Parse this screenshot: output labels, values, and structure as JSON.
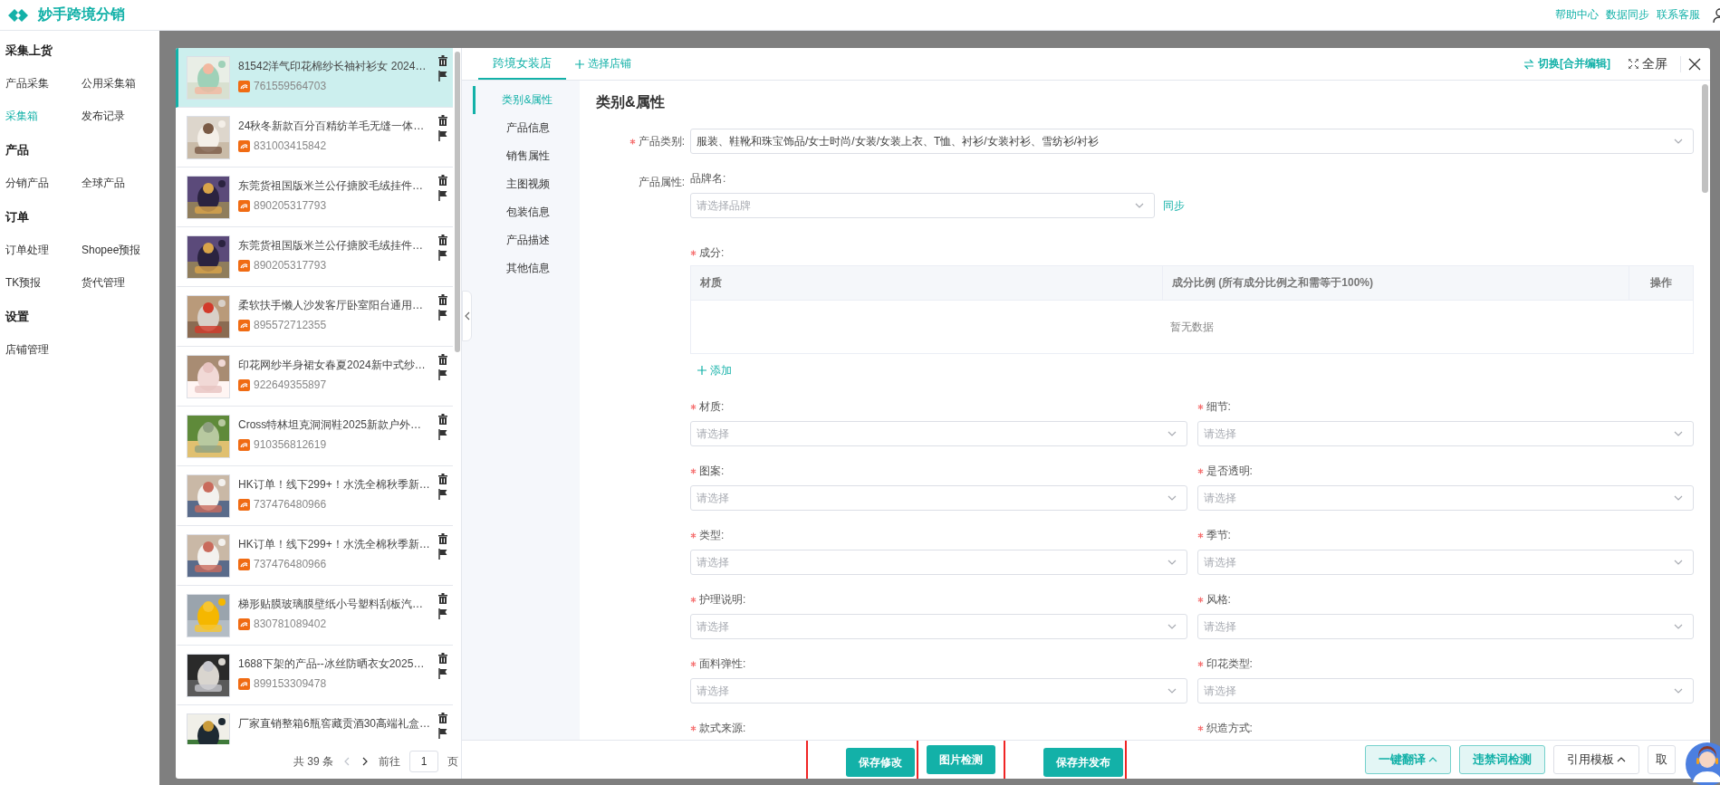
{
  "app": {
    "title": "妙手跨境分销"
  },
  "header_links": [
    "帮助中心",
    "数据同步",
    "联系客服"
  ],
  "sidebar": {
    "sections": [
      {
        "title": "采集上货",
        "items": [
          {
            "label": "产品采集",
            "selected": false
          },
          {
            "label": "公用采集箱",
            "selected": false
          },
          {
            "label": "采集箱",
            "selected": true
          },
          {
            "label": "发布记录",
            "selected": false
          }
        ]
      },
      {
        "title": "产品",
        "items": [
          {
            "label": "分销产品",
            "selected": false
          },
          {
            "label": "全球产品",
            "selected": false
          }
        ]
      },
      {
        "title": "订单",
        "items": [
          {
            "label": "订单处理",
            "selected": false
          },
          {
            "label": "Shopee预报",
            "selected": false
          },
          {
            "label": "TK预报",
            "selected": false
          },
          {
            "label": "货代管理",
            "selected": false
          }
        ]
      },
      {
        "title": "设置",
        "items": [
          {
            "label": "店铺管理",
            "selected": false
          }
        ]
      }
    ]
  },
  "product_list": {
    "items": [
      {
        "title": "81542洋气印花棉纱长袖衬衫女 2024…",
        "id": "761559564703",
        "selected": true,
        "kind": "picture"
      },
      {
        "title": "24秋冬新款百分百精纺羊毛无缝一体…",
        "id": "831003415842",
        "selected": false,
        "kind": "picture"
      },
      {
        "title": "东莞货祖国版米兰公仔搪胶毛绒挂件…",
        "id": "890205317793",
        "selected": false,
        "kind": "picture"
      },
      {
        "title": "东莞货祖国版米兰公仔搪胶毛绒挂件…",
        "id": "890205317793",
        "selected": false,
        "kind": "picture"
      },
      {
        "title": "柔软扶手懒人沙发客厅卧室阳台通用…",
        "id": "895572712355",
        "selected": false,
        "kind": "picture"
      },
      {
        "title": "印花网纱半身裙女春夏2024新中式纱…",
        "id": "922649355897",
        "selected": false,
        "kind": "picture"
      },
      {
        "title": "Cross特林坦克洞洞鞋2025新款户外…",
        "id": "910356812619",
        "selected": false,
        "kind": "picture"
      },
      {
        "title": "HK订单！线下299+！水洗全棉秋季新…",
        "id": "737476480966",
        "selected": false,
        "kind": "picture"
      },
      {
        "title": "HK订单！线下299+！水洗全棉秋季新…",
        "id": "737476480966",
        "selected": false,
        "kind": "picture"
      },
      {
        "title": "梯形贴膜玻璃膜壁纸小号塑料刮板汽…",
        "id": "830781089402",
        "selected": false,
        "kind": "picture"
      },
      {
        "title": "1688下架的产品--冰丝防晒衣女2025…",
        "id": "899153309478",
        "selected": false,
        "kind": "picture"
      },
      {
        "title": "厂家直销整箱6瓶窖藏贡酒30高端礼盒…",
        "selected": false,
        "kind": "picture"
      }
    ],
    "pagination": {
      "total": "共 39 条",
      "goto": "前往",
      "page": "1",
      "unit": "页"
    }
  },
  "editor": {
    "tabs": [
      {
        "label": "跨境女装店",
        "selected": true
      }
    ],
    "add_shop": "选择店铺",
    "switch_mode": "切换[合并编辑]",
    "fullscreen": "全屏",
    "nav": [
      {
        "label": "类别&属性",
        "selected": true
      },
      {
        "label": "产品信息",
        "selected": false
      },
      {
        "label": "销售属性",
        "selected": false
      },
      {
        "label": "主图视频",
        "selected": false
      },
      {
        "label": "包装信息",
        "selected": false
      },
      {
        "label": "产品描述",
        "selected": false
      },
      {
        "label": "其他信息",
        "selected": false
      }
    ],
    "section_title": "类别&属性",
    "category": {
      "label": "产品类别:",
      "required": true,
      "value": "服装、鞋靴和珠宝饰品/女士时尚/女装/女装上衣、T恤、衬衫/女装衬衫、雪纺衫/衬衫"
    },
    "attributes_label": "产品属性:",
    "brand": {
      "label": "品牌名:",
      "required": false,
      "placeholder": "请选择品牌",
      "sync": "同步"
    },
    "composition": {
      "label": "成分:",
      "required": true,
      "columns": [
        "材质",
        "成分比例 (所有成分比例之和需等于100%)",
        "操作"
      ],
      "empty": "暂无数据",
      "add": "添加"
    },
    "fields": [
      {
        "label": "材质:",
        "required": true,
        "placeholder": "请选择"
      },
      {
        "label": "细节:",
        "required": true,
        "placeholder": "请选择"
      },
      {
        "label": "图案:",
        "required": true,
        "placeholder": "请选择"
      },
      {
        "label": "是否透明:",
        "required": true,
        "placeholder": "请选择"
      },
      {
        "label": "类型:",
        "required": true,
        "placeholder": "请选择"
      },
      {
        "label": "季节:",
        "required": true,
        "placeholder": "请选择"
      },
      {
        "label": "护理说明:",
        "required": true,
        "placeholder": "请选择"
      },
      {
        "label": "风格:",
        "required": true,
        "placeholder": "请选择"
      },
      {
        "label": "面料弹性:",
        "required": true,
        "placeholder": "请选择"
      },
      {
        "label": "印花类型:",
        "required": true,
        "placeholder": "请选择"
      },
      {
        "label": "款式来源:",
        "required": true
      },
      {
        "label": "织造方式:",
        "required": true
      }
    ],
    "footer": {
      "center_buttons": [
        {
          "label": "保存修改",
          "highlighted": true
        },
        {
          "label": "图片检测",
          "highlighted": false
        },
        {
          "label": "保存并发布",
          "highlighted": true
        }
      ],
      "right_buttons": [
        {
          "label": "一键翻译",
          "kind": "light",
          "caret": true
        },
        {
          "label": "违禁词检测",
          "kind": "light",
          "caret": false
        },
        {
          "label": "引用模板",
          "kind": "plain",
          "caret": true
        },
        {
          "label": "取",
          "kind": "plain",
          "caret": false
        }
      ]
    }
  }
}
